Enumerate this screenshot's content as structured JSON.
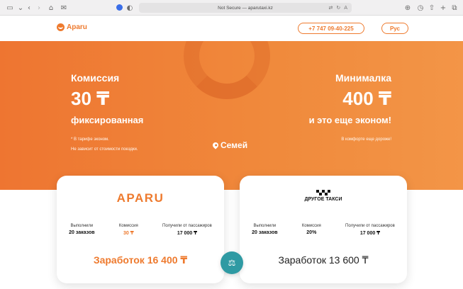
{
  "browser": {
    "address": "Not Secure — aparutaxi.kz",
    "nav_icons": [
      "sidebar-icon",
      "back-icon",
      "forward-icon",
      "home-icon",
      "mail-icon"
    ],
    "toolbar_icons": [
      "download-icon",
      "history-icon",
      "share-icon",
      "new-tab-icon",
      "tabs-icon"
    ]
  },
  "header": {
    "logo_text": "Aparu",
    "phone": "+7 747 09-40-225",
    "lang": "Рус"
  },
  "hero": {
    "left_title": "Комиссия",
    "left_value": "30 ₸",
    "left_sub": "фиксированная",
    "note_1": "* В тарифе эконом.",
    "note_2": "Не зависит от стоимости поездки.",
    "right_title": "Минималка",
    "right_value": "400 ₸",
    "right_sub": "и это еще эконом!",
    "note_3": "В комфорте еще дороже!",
    "city": "Семей"
  },
  "cards": {
    "left": {
      "brand": "APARU",
      "stats": [
        {
          "label": "Выполнили",
          "value": "20 заказов"
        },
        {
          "label": "Комиссия",
          "value": "30 ₸"
        },
        {
          "label": "Получили от пассажиров",
          "value": "17 000 ₸"
        }
      ],
      "earnings": "Заработок 16 400 ₸"
    },
    "right": {
      "brand": "ДРУГОЕ ТАКСИ",
      "stats": [
        {
          "label": "Выполнили",
          "value": "20 заказов"
        },
        {
          "label": "Комиссия",
          "value": "20%"
        },
        {
          "label": "Получили от пассажиров",
          "value": "17 000 ₸"
        }
      ],
      "earnings": "Заработок 13 600 ₸"
    }
  },
  "compare_icon": "scales-icon",
  "colors": {
    "accent": "#ee7a2e",
    "compare": "#2f9aa3"
  }
}
